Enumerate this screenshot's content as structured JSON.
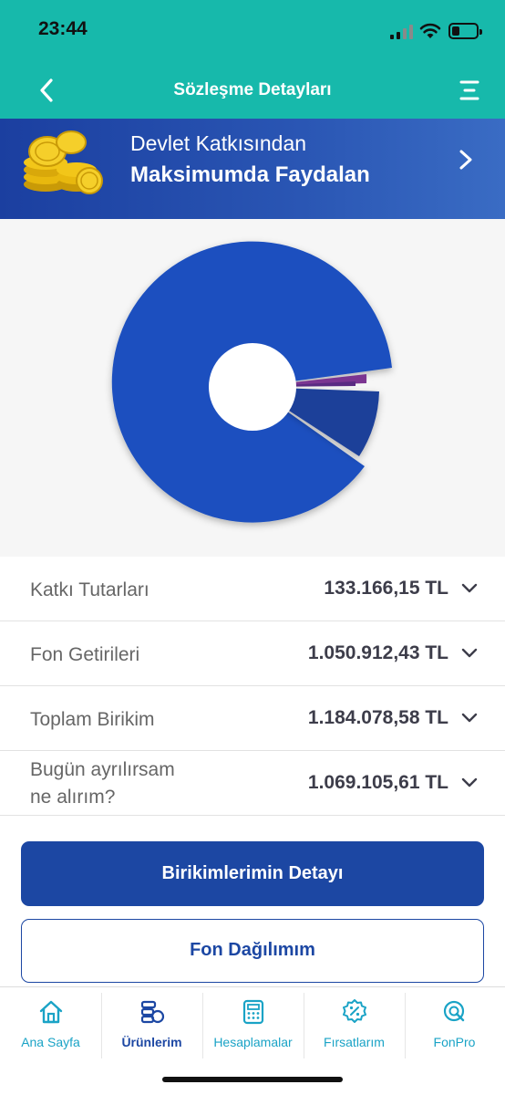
{
  "status": {
    "time": "23:44"
  },
  "nav": {
    "title": "Sözleşme Detayları"
  },
  "banner": {
    "line1": "Devlet Katkısından",
    "line2": "Maksimumda Faydalan"
  },
  "colors": {
    "teal": "#17b9ab",
    "navy": "#1c47a3",
    "chart_blue": "#1a4fbf",
    "chart_dark": "#1d3f99",
    "chart_purple": "#7b3591"
  },
  "summary": {
    "rows": [
      {
        "label": "Katkı Tutarları",
        "value": "133.166,15 TL"
      },
      {
        "label": "Fon Getirileri",
        "value": "1.050.912,43 TL"
      },
      {
        "label": "Toplam Birikim",
        "value": "1.184.078,58 TL"
      },
      {
        "label_line1": "Bugün ayrılırsam",
        "label_line2": "ne alırım?",
        "value": "1.069.105,61 TL"
      }
    ]
  },
  "buttons": {
    "primary": "Birikimlerimin Detayı",
    "secondary": "Fon Dağılımım"
  },
  "tabs": [
    {
      "label": "Ana Sayfa",
      "icon": "home-icon"
    },
    {
      "label": "Ürünlerim",
      "icon": "products-icon"
    },
    {
      "label": "Hesaplamalar",
      "icon": "calculator-icon"
    },
    {
      "label": "Fırsatlarım",
      "icon": "percent-badge-icon"
    },
    {
      "label": "FonPro",
      "icon": "fonpro-search-icon"
    }
  ]
}
